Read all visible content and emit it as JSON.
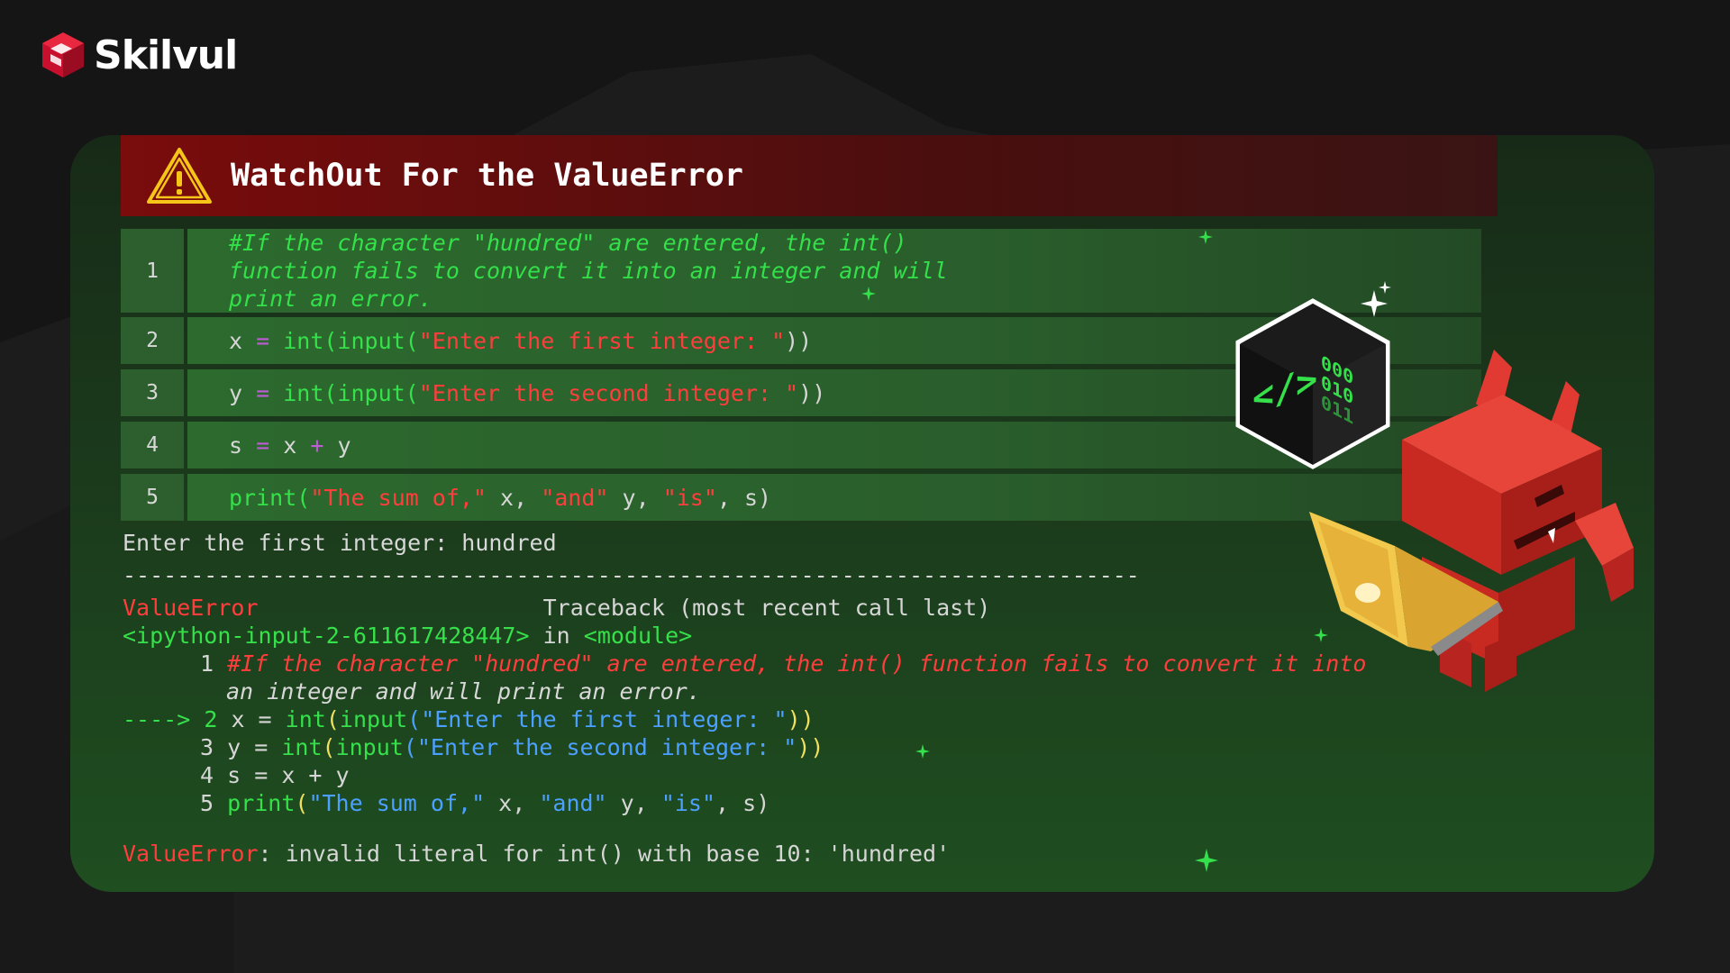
{
  "brand": {
    "name": "Skilvul"
  },
  "header": {
    "title": "WatchOut For the ValueError"
  },
  "code_lines": [
    {
      "num": "1",
      "comment": "#If the character \"hundred\" are entered, the int() function fails to convert it into an integer and will print an error."
    },
    {
      "num": "2",
      "var": "x",
      "eq": " = ",
      "fn": "int(input(",
      "str": "\"Enter the first integer: \"",
      "close": "))"
    },
    {
      "num": "3",
      "var": "y",
      "eq": " = ",
      "fn": "int(input(",
      "str": "\"Enter the second integer: \"",
      "close": "))"
    },
    {
      "num": "4",
      "a": "s",
      "eq": " = ",
      "x": "x",
      "plus": " + ",
      "y": "y"
    },
    {
      "num": "5",
      "fn": "print(",
      "s1": "\"The sum of,\"",
      "t1": " x, ",
      "s2": "\"and\"",
      "t2": " y, ",
      "s3": "\"is\"",
      "t3": ", s)"
    }
  ],
  "output": {
    "prompt_line": "Enter the first integer: hundred",
    "divider": "---------------------------------------------------------------------------",
    "error_name": "ValueError",
    "traceback_label": "Traceback (most recent call last)",
    "input_ref": "<ipython-input-2-611617428447>",
    "in_word": " in ",
    "module": "<module>",
    "tb1_num": "1",
    "tb1_comment_a": "#If the character \"hundred\" are entered, the int() function fails to convert it into",
    "tb1_comment_b": "an integer and will print an error.",
    "arrow": "---->",
    "tb2_num": "2",
    "tb2_a": "x = ",
    "tb2_fn1": "int",
    "tb2_p": "(",
    "tb2_fn2": "input",
    "tb2_str": "(\"Enter the first integer: \"",
    "tb2_close": "))",
    "tb3_num": "3",
    "tb3_a": "y = ",
    "tb3_fn1": "int",
    "tb3_p": "(",
    "tb3_fn2": "input",
    "tb3_str": "(\"Enter the second integer: \"",
    "tb3_close": "))",
    "tb4_num": "4",
    "tb4_code": "s = x + y",
    "tb5_num": "5",
    "tb5_fn": "print",
    "tb5_p": "(",
    "tb5_s1": "\"The sum of,\"",
    "tb5_t1": " x, ",
    "tb5_s2": "\"and\"",
    "tb5_t2": " y, ",
    "tb5_s3": "\"is\"",
    "tb5_t3": ", s)",
    "final_error": "ValueError",
    "final_msg": ": invalid literal for int() with base 10: 'hundred'"
  },
  "badge": {
    "glyph": "</>",
    "binary": [
      "000",
      "010",
      "011"
    ]
  },
  "colors": {
    "accent_red": "#c8102e",
    "code_green": "#35e04b",
    "string_red": "#ff3d3d",
    "keyword_blue": "#4ca0ff"
  },
  "icons": [
    "skilvul-logo-icon",
    "warning-triangle-icon",
    "code-cube-icon",
    "devil-mascot-icon",
    "sparkle-icon"
  ]
}
